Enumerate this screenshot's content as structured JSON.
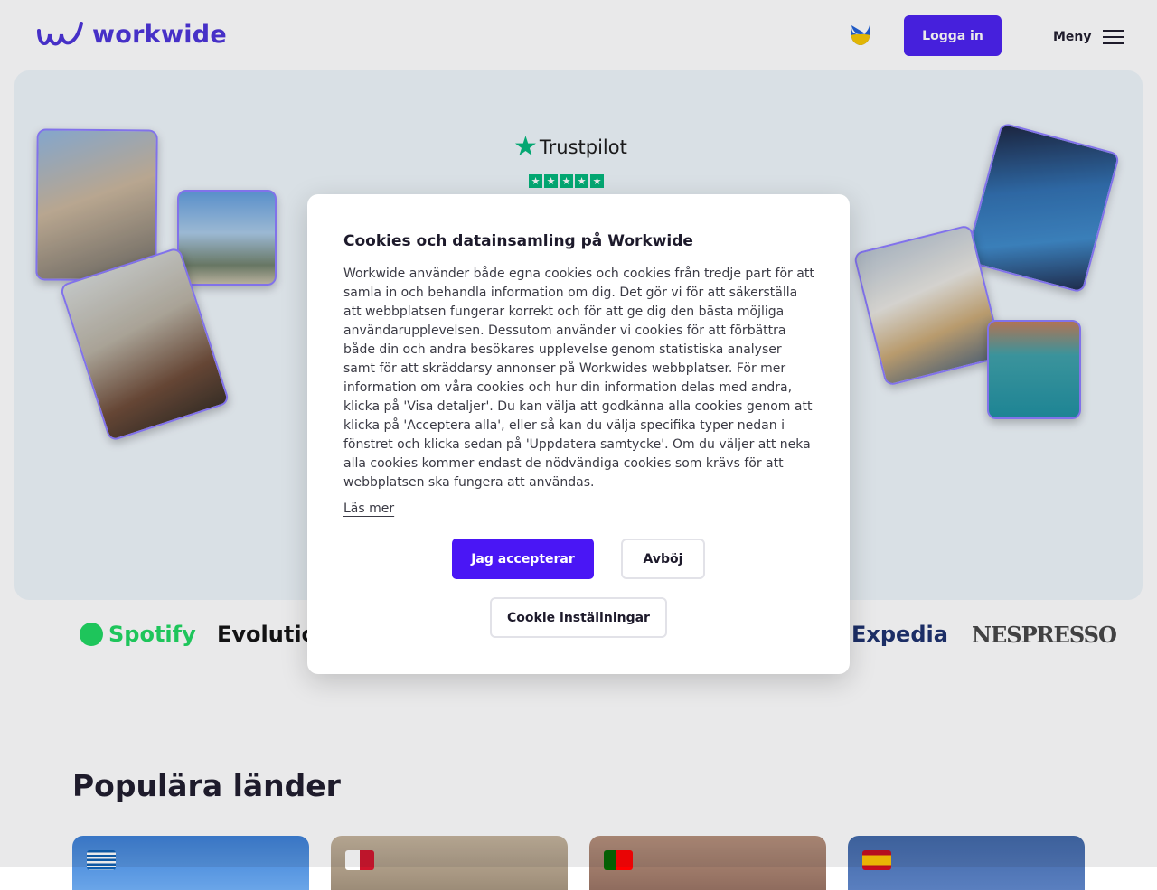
{
  "header": {
    "logo_text": "workwide",
    "login_label": "Logga in",
    "menu_label": "Meny"
  },
  "hero": {
    "trustpilot_label": "Trustpilot",
    "trustpilot_stars": 5
  },
  "brands": [
    "Spotify",
    "Evolutio",
    "Expedia",
    "NESPRESSO"
  ],
  "popular": {
    "title": "Populära länder"
  },
  "cookie_modal": {
    "title": "Cookies och datainsamling på Workwide",
    "body": "Workwide använder både egna cookies och cookies från tredje part för att samla in och behandla information om dig. Det gör vi för att säkerställa att webbplatsen fungerar korrekt och för att ge dig den bästa möjliga användarupplevelsen. Dessutom använder vi cookies för att förbättra både din och andra besökares upplevelse genom statistiska analyser samt för att skräddarsy annonser på Workwides webbplatser. För mer information om våra cookies och hur din information delas med andra, klicka på 'Visa detaljer'. Du kan välja att godkänna alla cookies genom att klicka på 'Acceptera alla', eller så kan du välja specifika typer nedan i fönstret och klicka sedan på 'Uppdatera samtycke'. Om du väljer att neka alla cookies kommer endast de nödvändiga cookies som krävs för att webbplatsen ska fungera att användas.",
    "read_more": "Läs mer",
    "accept_label": "Jag accepterar",
    "decline_label": "Avböj",
    "settings_label": "Cookie inställningar"
  },
  "colors": {
    "brand": "#4a31d9",
    "primary_button": "#4a16f5",
    "trustpilot_green": "#00b67a"
  }
}
